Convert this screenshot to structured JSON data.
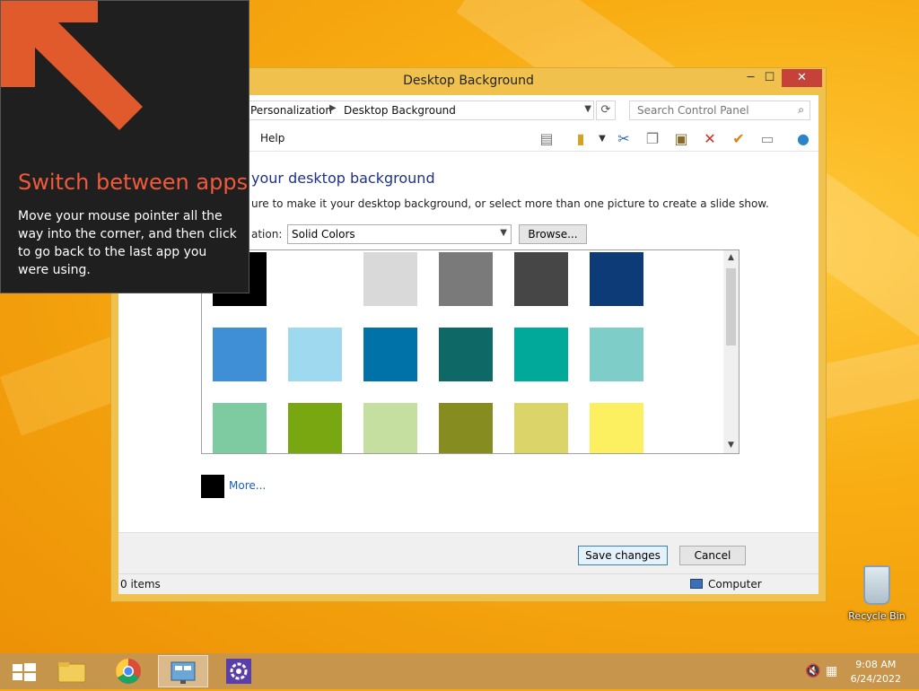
{
  "window": {
    "title": "Desktop Background",
    "minimize": "─",
    "maximize": "☐",
    "close": "✕"
  },
  "address": {
    "crumbs": [
      "Personalization",
      "Desktop Background"
    ],
    "search_placeholder": "Search Control Panel"
  },
  "menu": {
    "help": "Help"
  },
  "content": {
    "heading": "your desktop background",
    "subtext": "ure to make it your desktop background, or select more than one picture to create a slide show.",
    "location_label": "ation:",
    "location_value": "Solid Colors",
    "browse": "Browse...",
    "more": "More..."
  },
  "swatches": [
    "#000000",
    "#ffffff",
    "#d9d9d9",
    "#7a7a7a",
    "#464646",
    "#0d3b78",
    "#3e8fd6",
    "#9fd9ef",
    "#0072a8",
    "#0e6866",
    "#00a999",
    "#7ecdc8",
    "#7ecba1",
    "#78a712",
    "#c5dfa0",
    "#868c20",
    "#dbd468",
    "#fcf060"
  ],
  "footer": {
    "save": "Save changes",
    "cancel": "Cancel"
  },
  "status": {
    "items": "0 items",
    "location": "Computer"
  },
  "tip": {
    "title": "Switch between apps",
    "body": "Move your mouse pointer all the way into the corner, and then click to go back to the last app you were using."
  },
  "desktop": {
    "recycle_bin": "Recycle Bin"
  },
  "clock": {
    "time": "9:08 AM",
    "date": "6/24/2022"
  }
}
